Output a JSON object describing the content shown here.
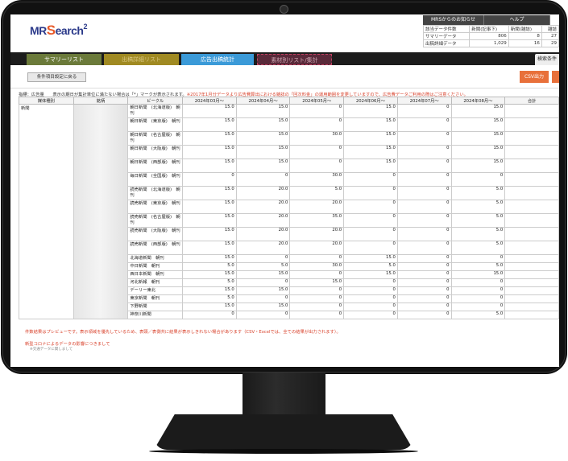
{
  "header": {
    "logo_main": "MR",
    "logo_s": "S",
    "logo_rest": "earch",
    "logo_sup": "2",
    "nav": [
      "MRSからのお知らせ",
      "ヘルプ"
    ],
    "stats_header": [
      "該当データ件数",
      "新聞(記事下)",
      "新聞(雑誌)",
      "雑誌"
    ],
    "stats_rows": [
      [
        "サマリーデータ",
        "806",
        "8",
        "27"
      ],
      [
        "出稿詳細データ",
        "1,029",
        "16",
        "29"
      ]
    ]
  },
  "tabs": [
    "サマリーリスト",
    "出稿詳細リスト",
    "広告出稿統計",
    "素材別リスト/集計"
  ],
  "tab_right": "検索条件",
  "toolbar": {
    "back_label": "条件項目設定に戻る",
    "csv_label": "CSV出力"
  },
  "notice": {
    "prefix": "指標：広告量　　表示の期日が集計単位に満たない場合は「*」マークが表示されます。",
    "red": "※2017年1月分データより広告費算出における雑誌の「回次料金」の運用範囲を変更していますので、広告費データご利用の際はご注意ください。"
  },
  "table": {
    "headers": [
      "媒体種別",
      "銘柄",
      "ビークル",
      "2024年03月～",
      "2024年04月～",
      "2024年05月～",
      "2024年06月～",
      "2024年07月～",
      "2024年08月～",
      "合計"
    ],
    "media_type": "新聞",
    "rows": [
      {
        "vehicle": "朝日新聞　(北海道版)　朝刊",
        "values": [
          "15.0",
          "15.0",
          "0",
          "15.0",
          "0",
          "15.0"
        ]
      },
      {
        "vehicle": "朝日新聞　(東京版)　朝刊",
        "values": [
          "15.0",
          "15.0",
          "0",
          "15.0",
          "0",
          "15.0"
        ]
      },
      {
        "vehicle": "朝日新聞　(名古屋版)　朝刊",
        "values": [
          "15.0",
          "15.0",
          "30.0",
          "15.0",
          "0",
          "15.0"
        ]
      },
      {
        "vehicle": "朝日新聞　(大阪版)　朝刊",
        "values": [
          "15.0",
          "15.0",
          "0",
          "15.0",
          "0",
          "15.0"
        ]
      },
      {
        "vehicle": "朝日新聞　(西部版)　朝刊",
        "values": [
          "15.0",
          "15.0",
          "0",
          "15.0",
          "0",
          "15.0"
        ]
      },
      {
        "vehicle": "毎日新聞　(全国版)　朝刊",
        "values": [
          "0",
          "0",
          "30.0",
          "0",
          "0",
          "0"
        ]
      },
      {
        "vehicle": "読売新聞　(北海道版)　朝刊",
        "values": [
          "15.0",
          "20.0",
          "5.0",
          "0",
          "0",
          "5.0"
        ]
      },
      {
        "vehicle": "読売新聞　(東京版)　朝刊",
        "values": [
          "15.0",
          "20.0",
          "20.0",
          "0",
          "0",
          "5.0"
        ]
      },
      {
        "vehicle": "読売新聞　(名古屋版)　朝刊",
        "values": [
          "15.0",
          "20.0",
          "35.0",
          "0",
          "0",
          "5.0"
        ]
      },
      {
        "vehicle": "読売新聞　(大阪版)　朝刊",
        "values": [
          "15.0",
          "20.0",
          "20.0",
          "0",
          "0",
          "5.0"
        ]
      },
      {
        "vehicle": "読売新聞　(西部版)　朝刊",
        "values": [
          "15.0",
          "20.0",
          "20.0",
          "0",
          "0",
          "5.0"
        ]
      },
      {
        "vehicle": "北海道新聞　朝刊",
        "values": [
          "15.0",
          "0",
          "0",
          "15.0",
          "0",
          "0"
        ]
      },
      {
        "vehicle": "中日新聞　朝刊",
        "values": [
          "5.0",
          "5.0",
          "30.0",
          "5.0",
          "0",
          "5.0"
        ]
      },
      {
        "vehicle": "西日本新聞　朝刊",
        "values": [
          "15.0",
          "15.0",
          "0",
          "15.0",
          "0",
          "15.0"
        ]
      },
      {
        "vehicle": "河北新報　朝刊",
        "values": [
          "5.0",
          "0",
          "15.0",
          "0",
          "0",
          "0"
        ]
      },
      {
        "vehicle": "デーリー東北",
        "values": [
          "15.0",
          "15.0",
          "0",
          "0",
          "0",
          "0"
        ]
      },
      {
        "vehicle": "東京新聞　朝刊",
        "values": [
          "5.0",
          "0",
          "0",
          "0",
          "0",
          "0"
        ]
      },
      {
        "vehicle": "下野新聞",
        "values": [
          "15.0",
          "15.0",
          "0",
          "0",
          "0",
          "0"
        ]
      },
      {
        "vehicle": "神奈川新聞",
        "values": [
          "0",
          "0",
          "0",
          "0",
          "0",
          "5.0"
        ]
      }
    ]
  },
  "footer": {
    "line1": "件数結果はプレビューです。表示領域を優先しているため、表頭／表側共に結果が表示しきれない場合があります（CSV・Excelでは、全ての結果が出力されます）。",
    "line2": "新型コロナによるデータの影響につきまして",
    "line3": "※交通データに関しまして"
  }
}
